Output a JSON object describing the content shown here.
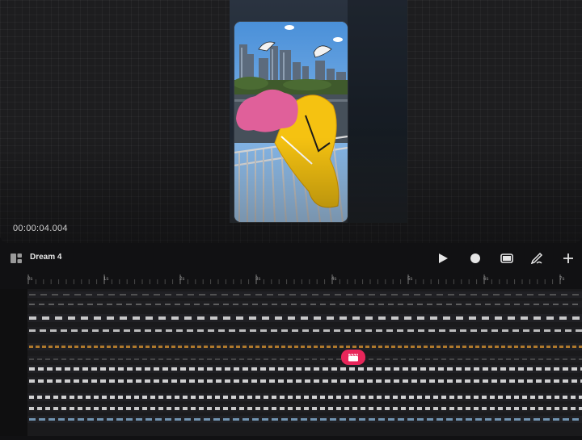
{
  "viewer": {
    "timecode": "00:00:04.004"
  },
  "toolbar": {
    "project_name": "Dream 4",
    "icons": [
      "layout-icon",
      "play-icon",
      "record-icon",
      "screen-icon",
      "draw-icon",
      "add-icon"
    ]
  },
  "ruler": {
    "labels": [
      "0s",
      "1s",
      "2s",
      "3s",
      "4s",
      "5s",
      "6s",
      "7s"
    ]
  },
  "colors": {
    "accent": "#e8265a",
    "background": "#111113",
    "canvas": "#1d1d1f",
    "character_yellow": "#f5c211",
    "hair_pink": "#e0609a"
  }
}
